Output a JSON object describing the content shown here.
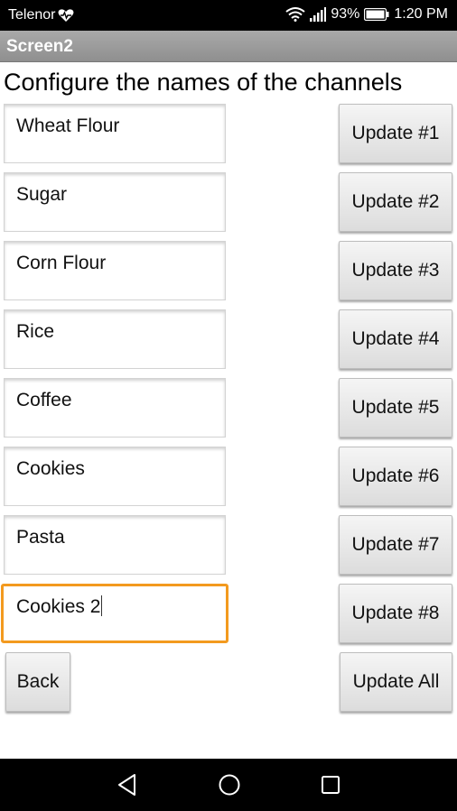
{
  "status_bar": {
    "carrier": "Telenor",
    "battery": "93%",
    "time": "1:20 PM"
  },
  "app": {
    "screen_title": "Screen2"
  },
  "main": {
    "heading": "Configure the names of the channels",
    "rows": [
      {
        "name": "Wheat Flour",
        "button": "Update #1"
      },
      {
        "name": "Sugar",
        "button": "Update #2"
      },
      {
        "name": "Corn Flour",
        "button": "Update #3"
      },
      {
        "name": "Rice",
        "button": "Update #4"
      },
      {
        "name": "Coffee",
        "button": "Update #5"
      },
      {
        "name": "Cookies",
        "button": "Update #6"
      },
      {
        "name": "Pasta",
        "button": "Update #7"
      },
      {
        "name": "Cookies 2",
        "button": "Update #8"
      }
    ],
    "focused_row": 8,
    "back_label": "Back",
    "update_all_label": "Update All"
  },
  "colors": {
    "focus_border": "#f39a1f",
    "title_bar": "#999999"
  },
  "icons": {
    "heart": "heart-pulse-icon",
    "wifi": "wifi-icon",
    "signal": "signal-icon",
    "battery": "battery-icon",
    "back": "nav-back-icon",
    "home": "nav-home-icon",
    "recents": "nav-recents-icon"
  }
}
